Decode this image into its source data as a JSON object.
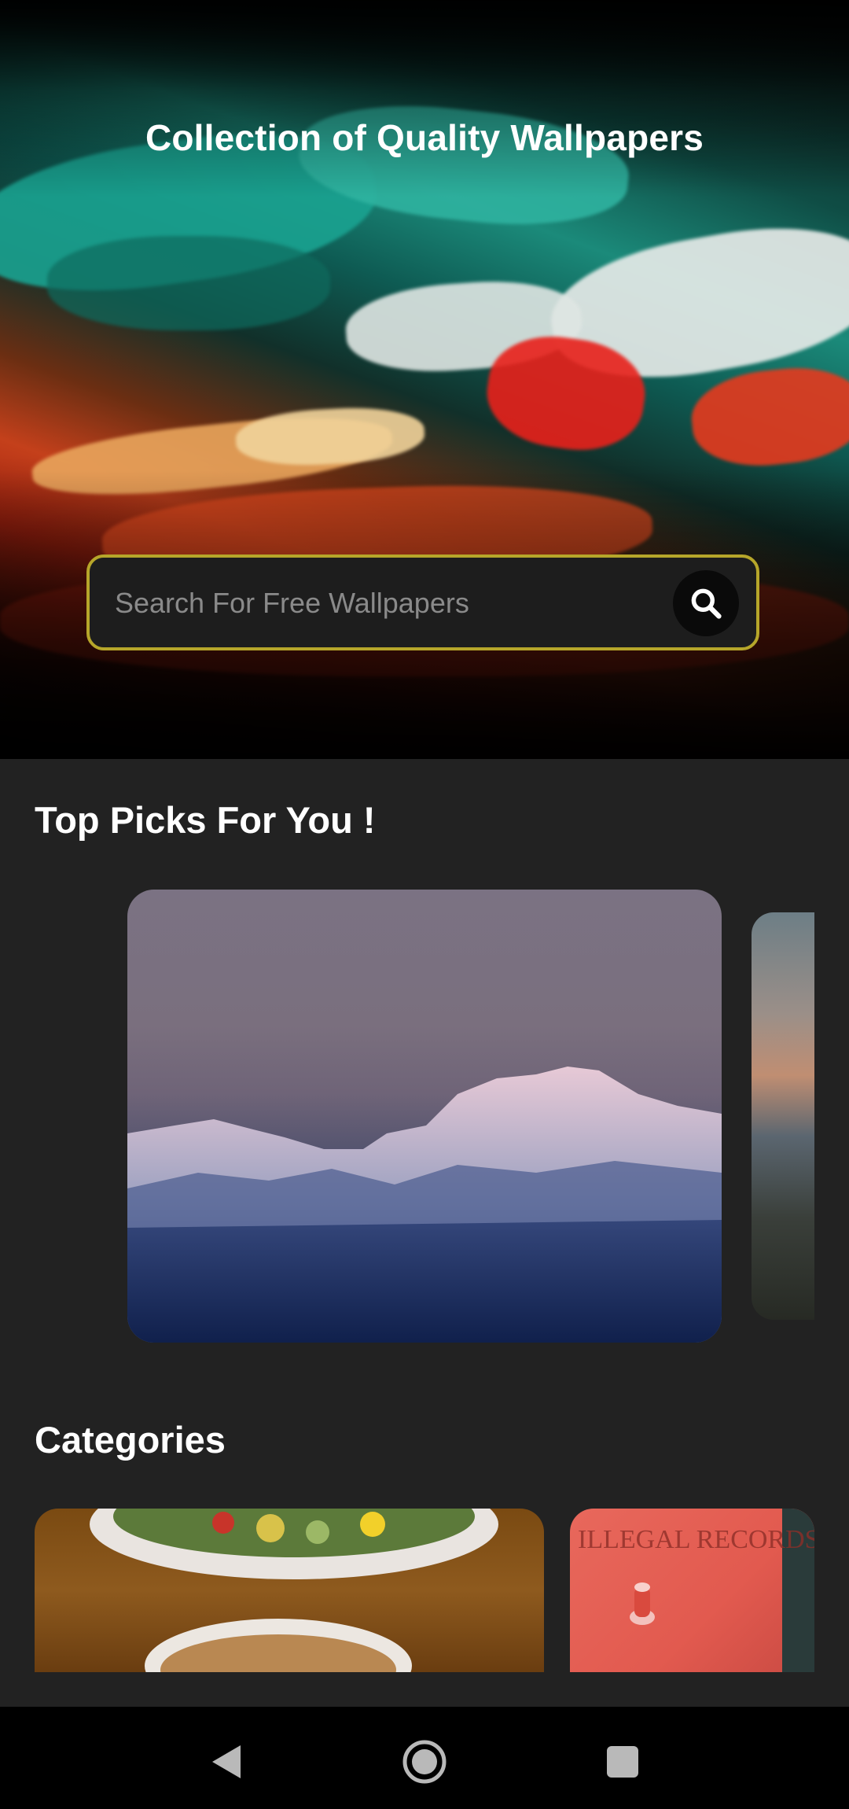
{
  "hero": {
    "title": "Collection of Quality Wallpapers",
    "search_placeholder": "Search For Free Wallpapers",
    "search_icon": "search-icon"
  },
  "top_picks": {
    "title": "Top Picks For You !",
    "items": [
      {
        "name": "snowy-mountain-range-wallpaper"
      },
      {
        "name": "sunset-landscape-wallpaper"
      }
    ]
  },
  "categories": {
    "title": "Categories",
    "items": [
      {
        "name": "food-category"
      },
      {
        "name": "music-category",
        "image_text": "ILLEGAL RECORDS"
      }
    ]
  },
  "navbar": {
    "back_icon": "back-triangle-icon",
    "home_icon": "home-circle-icon",
    "recents_icon": "recents-square-icon"
  },
  "colors": {
    "background": "#222222",
    "search_border": "#b6a62a",
    "text": "#ffffff"
  }
}
